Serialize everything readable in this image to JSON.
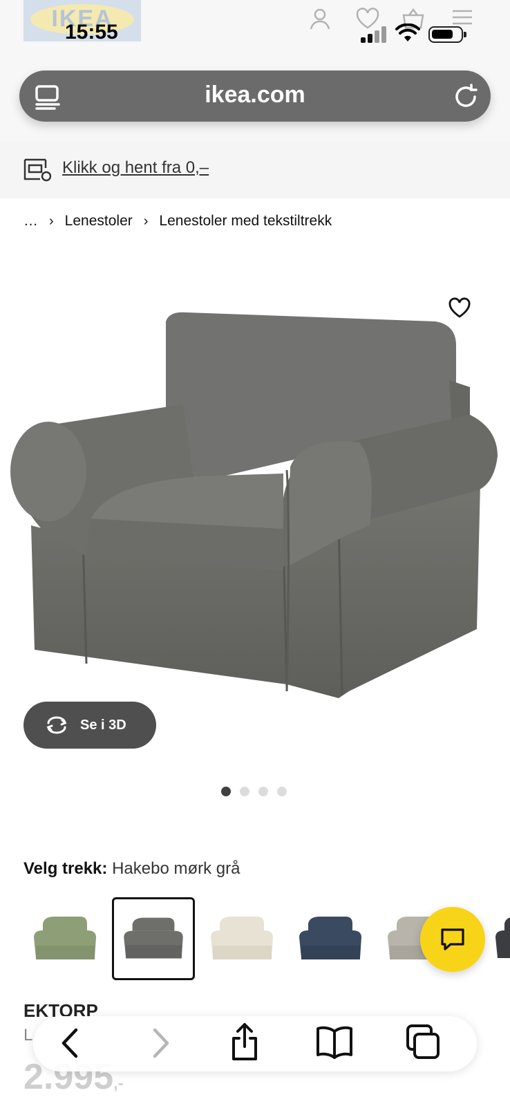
{
  "status": {
    "time": "15:55"
  },
  "site_header": {
    "logo_text": "IKEA"
  },
  "browser": {
    "url": "ikea.com"
  },
  "promo": {
    "text": "Klikk og hent fra 0,–"
  },
  "breadcrumb": [
    "…",
    "Lenestoler",
    "Lenestoler med tekstiltrekk"
  ],
  "gallery": {
    "view_3d_label": "Se i 3D",
    "dots_total": 4,
    "active_index": 0
  },
  "color_picker": {
    "label": "Velg trekk:",
    "selected": "Hakebo mørk grå",
    "swatches": [
      {
        "color": "#8e9e76",
        "selected": false
      },
      {
        "color": "#6e6e6b",
        "selected": true
      },
      {
        "color": "#e7e2d4",
        "selected": false
      },
      {
        "color": "#3a4a60",
        "selected": false
      },
      {
        "color": "#b8b3ab",
        "selected": false
      },
      {
        "color": "#3b3d40",
        "selected": false
      }
    ]
  },
  "product": {
    "name": "EKTORP",
    "type": "L",
    "price": "2.995",
    "price_suffix": ",-"
  },
  "colors": {
    "accent_yellow": "#f7d417",
    "sofa_grey": "#6e6e6b"
  }
}
